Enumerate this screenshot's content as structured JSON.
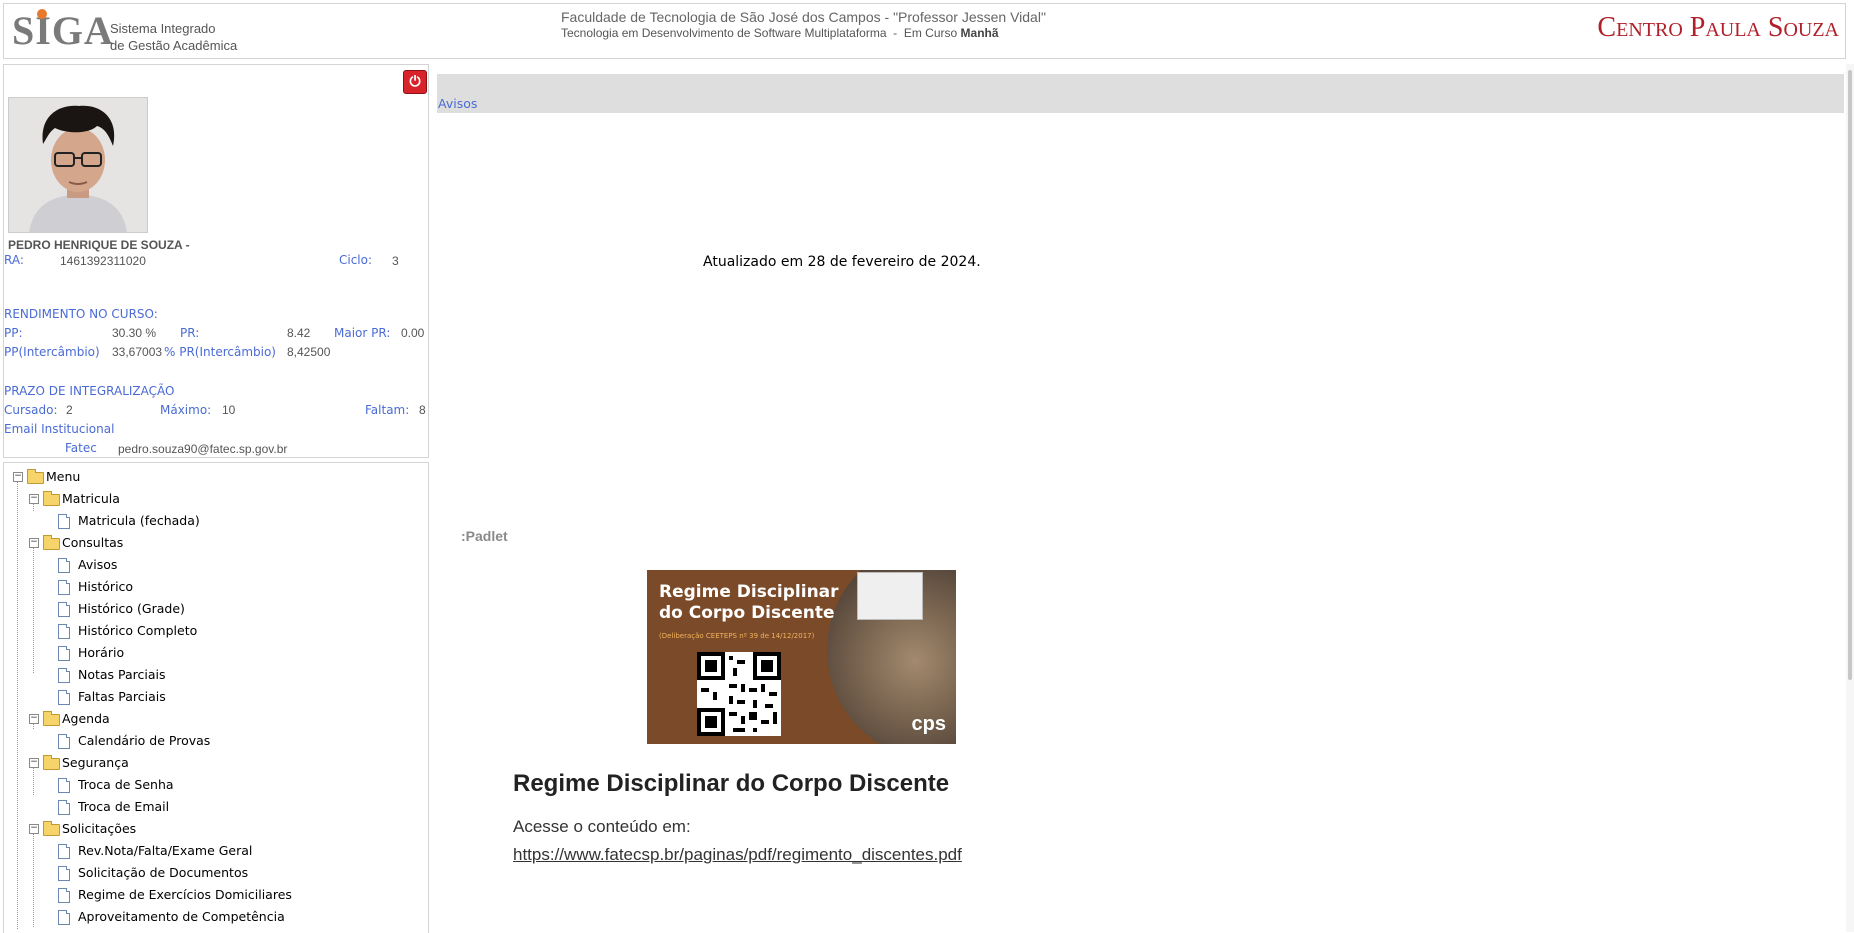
{
  "header": {
    "logo_text": "SIGA",
    "logo_subtitle_line1": "Sistema Integrado",
    "logo_subtitle_line2": "de Gestão Acadêmica",
    "institution": "Faculdade de Tecnologia de São José dos Campos - \"Professor Jessen Vidal\"",
    "course": "Tecnologia em Desenvolvimento de Software Multiplataforma",
    "course_separator": "-",
    "status": "Em Curso",
    "shift": "Manhã",
    "brand": "Centro Paula Souza"
  },
  "student": {
    "name": "PEDRO HENRIQUE DE SOUZA -",
    "ra_label": "RA:",
    "ra": "1461392311020",
    "ciclo_label": "Ciclo:",
    "ciclo": "3",
    "rendimento_title": "RENDIMENTO NO CURSO:",
    "pp_label": "PP:",
    "pp": "30.30 %",
    "pr_label": "PR:",
    "pr": "8.42",
    "maior_pr_label": "Maior PR:",
    "maior_pr": "0.00",
    "pp_inter_label": "PP(Intercâmbio)",
    "pp_inter": "33,67003",
    "pr_inter_label": "% PR(Intercâmbio)",
    "pr_inter": "8,42500",
    "prazo_title": "PRAZO DE INTEGRALIZAÇÃO",
    "cursado_label": "Cursado:",
    "cursado": "2",
    "maximo_label": "Máximo:",
    "maximo": "10",
    "faltam_label": "Faltam:",
    "faltam": "8",
    "email_label": "Email Institucional",
    "email_sub_label": "Fatec",
    "email": "pedro.souza90@fatec.sp.gov.br",
    "logout_icon": "power-icon"
  },
  "menu": {
    "root": "Menu",
    "groups": [
      {
        "label": "Matricula",
        "items": [
          "Matricula (fechada)"
        ]
      },
      {
        "label": "Consultas",
        "items": [
          "Avisos",
          "Histórico",
          "Histórico (Grade)",
          "Histórico Completo",
          "Horário",
          "Notas Parciais",
          "Faltas Parciais"
        ]
      },
      {
        "label": "Agenda",
        "items": [
          "Calendário de Provas"
        ]
      },
      {
        "label": "Segurança",
        "items": [
          "Troca de Senha",
          "Troca de Email"
        ]
      },
      {
        "label": "Solicitações",
        "items": [
          "Rev.Nota/Falta/Exame Geral",
          "Solicitação de Documentos",
          "Regime de Exercícios Domiciliares",
          "Aproveitamento de Competência"
        ]
      }
    ]
  },
  "content": {
    "breadcrumb": "Avisos",
    "updated": "Atualizado em 28 de fevereiro de 2024.",
    "padlet": ":Padlet",
    "banner_title_line1": "Regime Disciplinar",
    "banner_title_line2": "do Corpo Discente",
    "banner_subtitle": "(Deliberação CEETEPS nº 39 de 14/12/2017)",
    "banner_mark": "cps",
    "regime_title": "Regime Disciplinar do Corpo Discente",
    "acesse": "Acesse o conteúdo em:",
    "link": "https://www.fatecsp.br/paginas/pdf/regimento_discentes.pdf"
  }
}
